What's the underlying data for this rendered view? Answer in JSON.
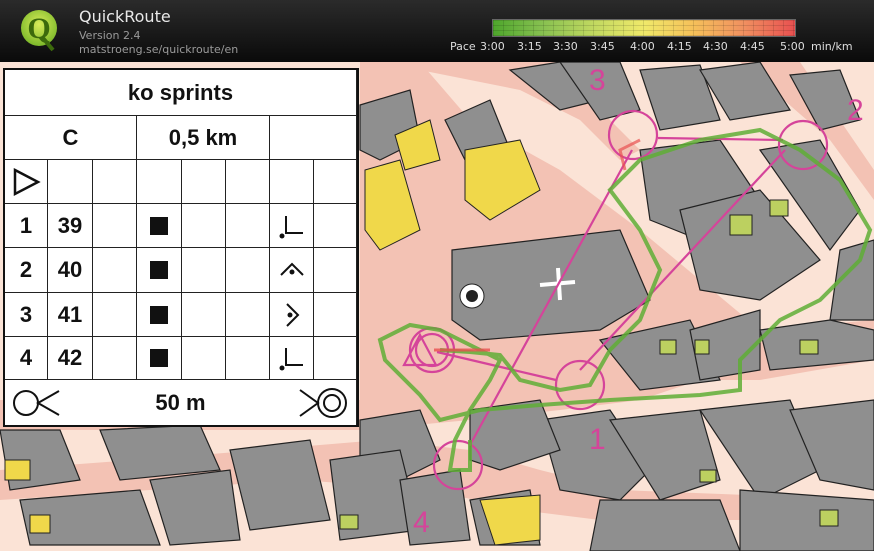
{
  "app": {
    "name": "QuickRoute",
    "version": "Version 2.4",
    "url": "matstroeng.se/quickroute/en"
  },
  "pace_scale": {
    "label": "Pace",
    "ticks": [
      "3:00",
      "3:15",
      "3:30",
      "3:45",
      "4:00",
      "4:15",
      "4:30",
      "4:45",
      "5:00"
    ],
    "unit": "min/km",
    "colors": {
      "fast": "#4ea62c",
      "mid": "#f0e96a",
      "slow": "#e85050"
    }
  },
  "control_card": {
    "event": "ko sprints",
    "course": "C",
    "length": "0,5 km",
    "controls": [
      {
        "number": "1",
        "code": "39"
      },
      {
        "number": "2",
        "code": "40"
      },
      {
        "number": "3",
        "code": "41"
      },
      {
        "number": "4",
        "code": "42"
      }
    ],
    "finish_distance": "50 m"
  },
  "map_labels": [
    "1",
    "2",
    "3",
    "4"
  ],
  "colors": {
    "course": "#d5449a",
    "road": "#f3c2b4",
    "building": "#8f8f8f",
    "open": "#fbe3d6",
    "yellow": "#f0d84a",
    "green": "#bcd060"
  }
}
